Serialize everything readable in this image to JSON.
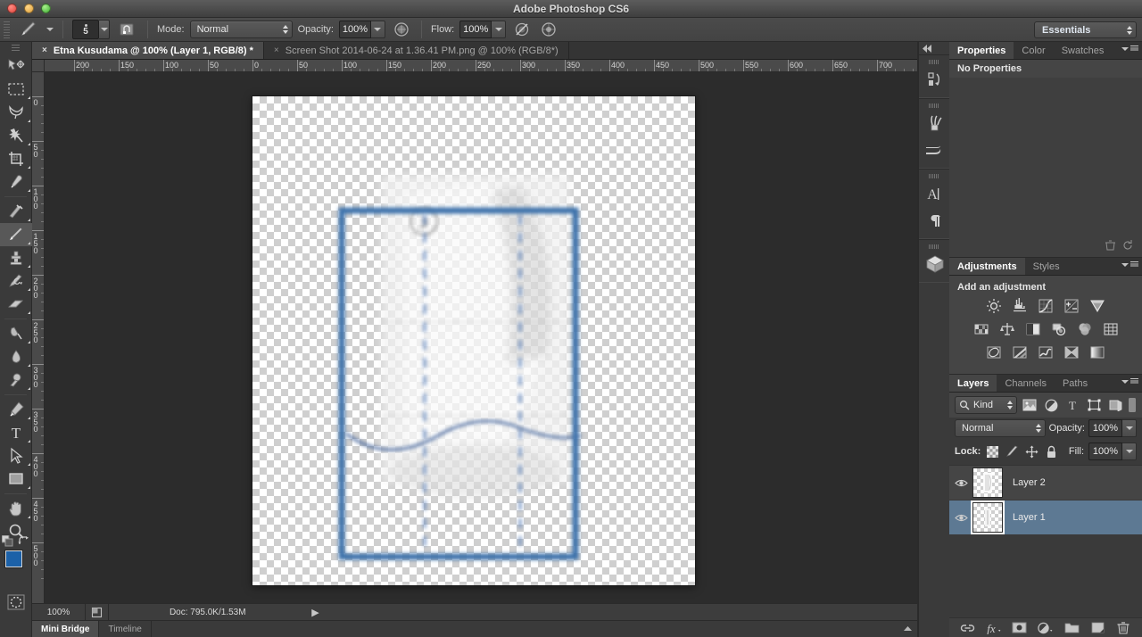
{
  "window": {
    "title": "Adobe Photoshop CS6"
  },
  "options_bar": {
    "brush_size": "5",
    "mode_label": "Mode:",
    "mode_value": "Normal",
    "opacity_label": "Opacity:",
    "opacity_value": "100%",
    "flow_label": "Flow:",
    "flow_value": "100%",
    "workspace": "Essentials",
    "icons": {
      "tool_preset": "brush-tool-icon",
      "brush_preset_picker": "brush-preset-caret-icon",
      "tablet_pressure_size": "tablet-pressure-size-icon",
      "airbrush": "airbrush-icon",
      "tablet_pressure_opacity": "tablet-pressure-opacity-icon",
      "airbrush2": "airbrush-flow-icon"
    }
  },
  "document_tabs": [
    {
      "title": "Etna Kusudama @ 100% (Layer 1, RGB/8) *",
      "active": true,
      "close": "×"
    },
    {
      "title": "Screen Shot 2014-06-24 at 1.36.41 PM.png @ 100% (RGB/8*)",
      "active": false,
      "close": "×"
    }
  ],
  "toolbar": {
    "tools": [
      {
        "name": "move-tool",
        "selected": false,
        "has_flyout": false
      },
      {
        "name": "rectangular-marquee-tool",
        "selected": false,
        "has_flyout": true
      },
      {
        "name": "lasso-tool",
        "selected": false,
        "has_flyout": true
      },
      {
        "name": "magic-wand-tool",
        "selected": false,
        "has_flyout": true
      },
      {
        "name": "crop-tool",
        "selected": false,
        "has_flyout": true
      },
      {
        "name": "eyedropper-tool",
        "selected": false,
        "has_flyout": true
      },
      {
        "name": "spot-healing-brush-tool",
        "selected": false,
        "has_flyout": true
      },
      {
        "name": "brush-tool",
        "selected": true,
        "has_flyout": true
      },
      {
        "name": "clone-stamp-tool",
        "selected": false,
        "has_flyout": true
      },
      {
        "name": "history-brush-tool",
        "selected": false,
        "has_flyout": true
      },
      {
        "name": "eraser-tool",
        "selected": false,
        "has_flyout": true
      },
      {
        "name": "gradient-tool",
        "selected": false,
        "has_flyout": true
      },
      {
        "name": "blur-tool",
        "selected": false,
        "has_flyout": true
      },
      {
        "name": "dodge-tool",
        "selected": false,
        "has_flyout": true
      },
      {
        "name": "pen-tool",
        "selected": false,
        "has_flyout": true
      },
      {
        "name": "type-tool",
        "selected": false,
        "has_flyout": true
      },
      {
        "name": "path-selection-tool",
        "selected": false,
        "has_flyout": true
      },
      {
        "name": "rectangle-shape-tool",
        "selected": false,
        "has_flyout": true
      },
      {
        "name": "hand-tool",
        "selected": false,
        "has_flyout": true
      },
      {
        "name": "zoom-tool",
        "selected": false,
        "has_flyout": false
      }
    ],
    "foreground_color": "#1c61a8",
    "background_color": "#ffffff",
    "quick_mask": "quick-mask-icon"
  },
  "rulers": {
    "unit_hint": "pixels",
    "horizontal_labels": [
      "200",
      "150",
      "100",
      "50",
      "0",
      "50",
      "100",
      "150",
      "200",
      "250",
      "300",
      "350",
      "400",
      "450",
      "500",
      "550",
      "600",
      "650",
      "700"
    ],
    "vertical_labels": [
      "0",
      "50",
      "100",
      "150",
      "200",
      "250",
      "300",
      "350",
      "400",
      "450",
      "500"
    ]
  },
  "status_bar": {
    "zoom": "100%",
    "doc_info": "Doc: 795.0K/1.53M",
    "arrow": "▶"
  },
  "bottom_tabs": [
    {
      "label": "Mini Bridge",
      "active": true
    },
    {
      "label": "Timeline",
      "active": false
    }
  ],
  "icon_rail": [
    {
      "name": "history-actions-icon"
    },
    {
      "name": "brush-panel-icon"
    },
    {
      "name": "brush-presets-icon"
    },
    {
      "name": "character-panel-icon",
      "glyph": "A"
    },
    {
      "name": "paragraph-panel-icon",
      "glyph": "¶"
    },
    {
      "name": "3d-panel-icon"
    }
  ],
  "properties_panel": {
    "tabs": [
      {
        "label": "Properties",
        "active": true
      },
      {
        "label": "Color",
        "active": false
      },
      {
        "label": "Swatches",
        "active": false
      }
    ],
    "empty_message": "No Properties"
  },
  "adjustments_panel": {
    "tabs": [
      {
        "label": "Adjustments",
        "active": true
      },
      {
        "label": "Styles",
        "active": false
      }
    ],
    "heading": "Add an adjustment",
    "rows": [
      [
        "brightness-contrast-icon",
        "levels-icon",
        "curves-icon",
        "exposure-icon",
        "vibrance-icon"
      ],
      [
        "hue-saturation-icon",
        "color-balance-icon",
        "black-white-icon",
        "photo-filter-icon",
        "channel-mixer-icon",
        "color-lookup-icon"
      ],
      [
        "invert-icon",
        "posterize-icon",
        "threshold-icon",
        "selective-color-icon",
        "gradient-map-icon"
      ]
    ]
  },
  "layers_panel": {
    "tabs": [
      {
        "label": "Layers",
        "active": true
      },
      {
        "label": "Channels",
        "active": false
      },
      {
        "label": "Paths",
        "active": false
      }
    ],
    "filter_label": "Kind",
    "filter_icons": [
      "pixel-layer-filter-icon",
      "adjustment-layer-filter-icon",
      "type-layer-filter-icon",
      "shape-layer-filter-icon",
      "smart-object-filter-icon",
      "filter-toggle-icon"
    ],
    "blend_mode": "Normal",
    "opacity_label": "Opacity:",
    "opacity_value": "100%",
    "lock_label": "Lock:",
    "lock_icons": [
      "lock-transparent-pixels-icon",
      "lock-image-pixels-icon",
      "lock-position-icon",
      "lock-all-icon"
    ],
    "fill_label": "Fill:",
    "fill_value": "100%",
    "layers": [
      {
        "name": "Layer 2",
        "visible": true,
        "selected": false
      },
      {
        "name": "Layer 1",
        "visible": true,
        "selected": true
      }
    ],
    "footer_icons": [
      "link-layers-icon",
      "layer-style-fx-icon",
      "add-layer-mask-icon",
      "new-adjustment-layer-icon",
      "new-group-icon",
      "new-layer-icon",
      "delete-layer-icon"
    ]
  },
  "canvas": {
    "artwork_name": "kusudama-fold-diagram",
    "shape_color": "#3d72ab",
    "fold_line_color": "#5f86bd"
  }
}
